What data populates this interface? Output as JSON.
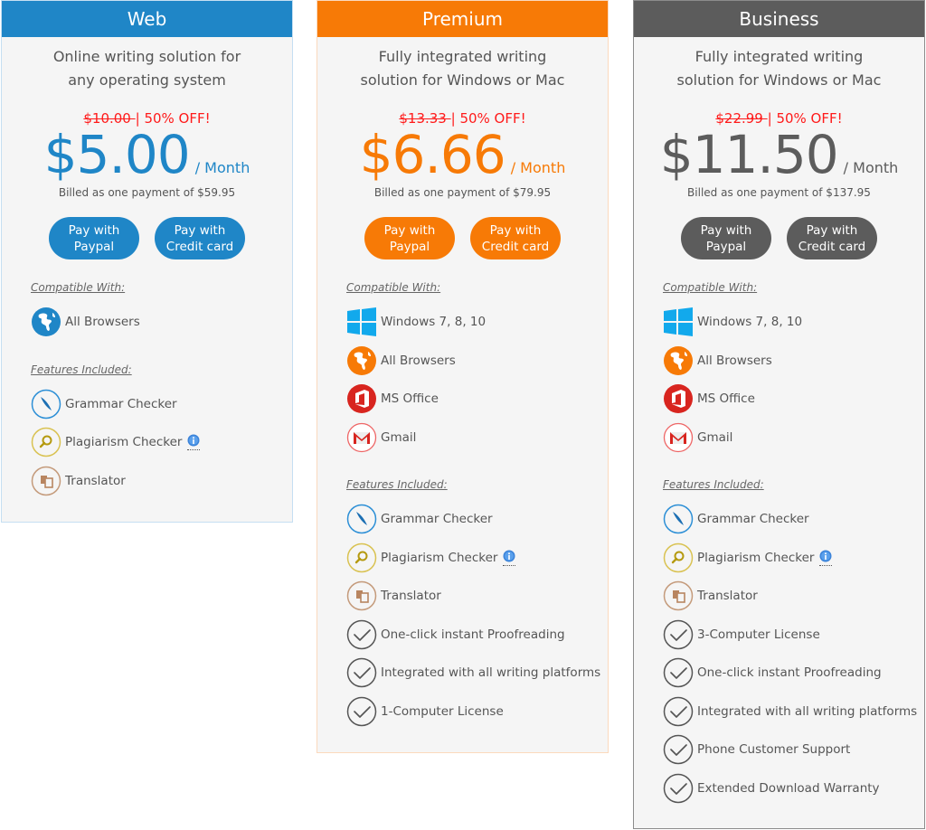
{
  "plans": [
    {
      "id": "web",
      "name": "Web",
      "accent": "#1f86c7",
      "description_line1": "Online writing solution for",
      "description_line2": "any operating system",
      "old_price": "$10.00 ",
      "discount": "| 50% OFF!",
      "price": "$5.00",
      "per": "/ Month",
      "billed": "Billed as one payment of $59.95",
      "paypal_line1": "Pay with",
      "paypal_line2": "Paypal",
      "card_line1": "Pay with",
      "card_line2": "Credit card",
      "compatible_title": "Compatible With:",
      "compatible": [
        {
          "icon": "globe-blue-icon",
          "label": "All Browsers"
        }
      ],
      "features_title": "Features Included:",
      "features": [
        {
          "icon": "grammar-checker-icon",
          "label": "Grammar Checker"
        },
        {
          "icon": "plagiarism-checker-icon",
          "label": "Plagiarism Checker",
          "info": true
        },
        {
          "icon": "translator-icon",
          "label": "Translator"
        }
      ]
    },
    {
      "id": "premium",
      "name": "Premium",
      "accent": "#f77a06",
      "description_line1": "Fully integrated writing",
      "description_line2": "solution for Windows or Mac",
      "old_price": "$13.33 ",
      "discount": "| 50% OFF!",
      "price": "$6.66",
      "per": "/ Month",
      "billed": "Billed as one payment of $79.95",
      "paypal_line1": "Pay with",
      "paypal_line2": "Paypal",
      "card_line1": "Pay with",
      "card_line2": "Credit card",
      "compatible_title": "Compatible With:",
      "compatible": [
        {
          "icon": "windows-icon",
          "label": "Windows 7, 8, 10"
        },
        {
          "icon": "globe-orange-icon",
          "label": "All Browsers"
        },
        {
          "icon": "ms-office-icon",
          "label": "MS Office"
        },
        {
          "icon": "gmail-icon",
          "label": "Gmail"
        }
      ],
      "features_title": "Features Included:",
      "features": [
        {
          "icon": "grammar-checker-icon",
          "label": "Grammar Checker"
        },
        {
          "icon": "plagiarism-checker-icon",
          "label": "Plagiarism Checker",
          "info": true
        },
        {
          "icon": "translator-icon",
          "label": "Translator"
        },
        {
          "icon": "checkmark-icon",
          "label": "One-click instant Proofreading"
        },
        {
          "icon": "checkmark-icon",
          "label": "Integrated with all writing platforms"
        },
        {
          "icon": "checkmark-icon",
          "label": "1-Computer License"
        }
      ]
    },
    {
      "id": "business",
      "name": "Business",
      "accent": "#5c5c5c",
      "description_line1": "Fully integrated writing",
      "description_line2": "solution for Windows or Mac",
      "old_price": "$22.99 ",
      "discount": "| 50% OFF!",
      "price": "$11.50",
      "per": "/ Month",
      "billed": "Billed as one payment of $137.95",
      "paypal_line1": "Pay with",
      "paypal_line2": "Paypal",
      "card_line1": "Pay with",
      "card_line2": "Credit card",
      "compatible_title": "Compatible With:",
      "compatible": [
        {
          "icon": "windows-icon",
          "label": "Windows 7, 8, 10"
        },
        {
          "icon": "globe-orange-icon",
          "label": "All Browsers"
        },
        {
          "icon": "ms-office-icon",
          "label": "MS Office"
        },
        {
          "icon": "gmail-icon",
          "label": "Gmail"
        }
      ],
      "features_title": "Features Included:",
      "features": [
        {
          "icon": "grammar-checker-icon",
          "label": "Grammar Checker"
        },
        {
          "icon": "plagiarism-checker-icon",
          "label": "Plagiarism Checker",
          "info": true
        },
        {
          "icon": "translator-icon",
          "label": "Translator"
        },
        {
          "icon": "checkmark-icon",
          "label": "3-Computer License"
        },
        {
          "icon": "checkmark-icon",
          "label": "One-click instant Proofreading"
        },
        {
          "icon": "checkmark-icon",
          "label": "Integrated with all writing platforms"
        },
        {
          "icon": "checkmark-icon",
          "label": "Phone Customer Support"
        },
        {
          "icon": "checkmark-icon",
          "label": "Extended Download Warranty"
        }
      ]
    }
  ],
  "colors": {
    "discount_red": "#ff1a1a",
    "card_bg": "#f5f5f5",
    "text": "#555555"
  }
}
